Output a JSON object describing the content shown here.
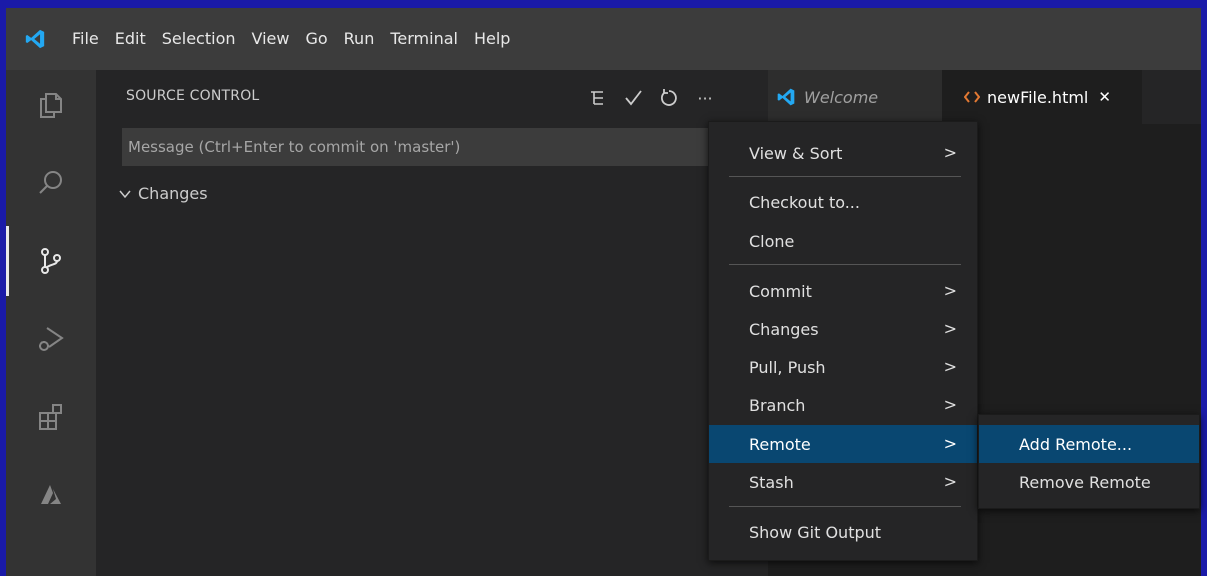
{
  "colors": {
    "accent": "#007acc",
    "menu_selection": "#094771",
    "html_icon": "#e37933",
    "frame_border": "#1a1aa8"
  },
  "menubar": {
    "logo_icon": "vscode-logo-icon",
    "items": [
      "File",
      "Edit",
      "Selection",
      "View",
      "Go",
      "Run",
      "Terminal",
      "Help"
    ]
  },
  "activitybar": {
    "icons": [
      "explorer-icon",
      "search-icon",
      "source-control-icon",
      "run-debug-icon",
      "extensions-icon",
      "azure-icon"
    ],
    "active": "source-control-icon"
  },
  "sidebar": {
    "title": "SOURCE CONTROL",
    "toolbar_icons": [
      "view-as-tree-icon",
      "commit-check-icon",
      "refresh-icon",
      "more-actions-icon"
    ],
    "more_label": "···",
    "commit_placeholder": "Message (Ctrl+Enter to commit on 'master')",
    "changes_label": "Changes"
  },
  "tabs": [
    {
      "label": "Welcome",
      "icon": "vscode-logo-icon",
      "active": false
    },
    {
      "label": "newFile.html",
      "icon": "html-file-icon",
      "active": true,
      "close": "✕"
    }
  ],
  "context_menu": {
    "items": [
      {
        "label": "View & Sort",
        "submenu": true
      },
      {
        "label": "Checkout to...",
        "submenu": false
      },
      {
        "label": "Clone",
        "submenu": false
      },
      {
        "label": "Commit",
        "submenu": true
      },
      {
        "label": "Changes",
        "submenu": true
      },
      {
        "label": "Pull, Push",
        "submenu": true
      },
      {
        "label": "Branch",
        "submenu": true
      },
      {
        "label": "Remote",
        "submenu": true,
        "selected": true
      },
      {
        "label": "Stash",
        "submenu": true
      },
      {
        "label": "Show Git Output",
        "submenu": false
      }
    ],
    "chevron": ">"
  },
  "remote_submenu": {
    "items": [
      {
        "label": "Add Remote...",
        "selected": true
      },
      {
        "label": "Remove Remote",
        "selected": false
      }
    ]
  }
}
